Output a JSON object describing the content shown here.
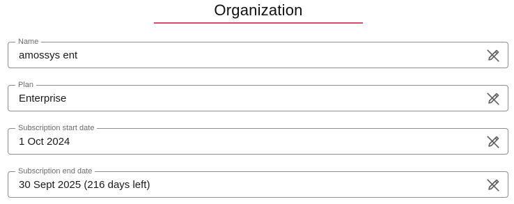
{
  "header": {
    "title": "Organization",
    "accent_color": "#e0456b"
  },
  "fields": [
    {
      "label": "Name",
      "value": "amossys ent",
      "action_icon": "edit-off-icon"
    },
    {
      "label": "Plan",
      "value": "Enterprise",
      "action_icon": "edit-off-icon"
    },
    {
      "label": "Subscription start date",
      "value": "1 Oct 2024",
      "action_icon": "edit-off-icon"
    },
    {
      "label": "Subscription end date",
      "value": "30 Sept 2025 (216 days left)",
      "action_icon": "edit-off-icon"
    }
  ]
}
